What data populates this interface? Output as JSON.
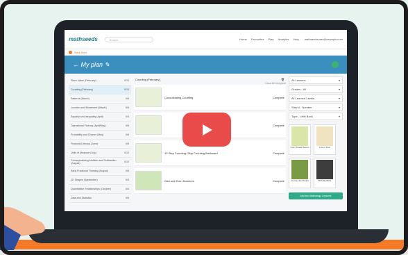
{
  "app": {
    "logo": "mathseeds",
    "search_placeholder": "Search"
  },
  "nav": {
    "links": [
      "Home",
      "Favourites",
      "Plan",
      "Analytics",
      "Help"
    ],
    "email": "mathseedsuser@example.com"
  },
  "back": {
    "label": "Back Alert"
  },
  "header": {
    "title": "My plan"
  },
  "months": [
    {
      "label": "Place Value (February)",
      "count": "0/10"
    },
    {
      "label": "Counting (February)",
      "count": "0/10",
      "active": true
    },
    {
      "label": "Patterns (March)",
      "count": "0/6"
    },
    {
      "label": "Location and Movement (March)",
      "count": "0/6"
    },
    {
      "label": "Equality and Inequality (April)",
      "count": "0/4"
    },
    {
      "label": "Operational Fluency (April/May)",
      "count": "0/6"
    },
    {
      "label": "Probability and Chance (May)",
      "count": "0/6"
    },
    {
      "label": "Financial Literacy (June)",
      "count": "0/6"
    },
    {
      "label": "Units of Measure (July)",
      "count": "0/10"
    },
    {
      "label": "Conceptualising Addition and Subtraction (August)",
      "count": "0/10"
    },
    {
      "label": "Early Fractional Thinking (August)",
      "count": "0/6"
    },
    {
      "label": "2D Shapes (September)",
      "count": "0/4"
    },
    {
      "label": "Quantitative Relationships (October)",
      "count": "0/6"
    },
    {
      "label": "Data and Statistics",
      "count": "0/6"
    }
  ],
  "main": {
    "title": "Counting (February)",
    "clear": "Clear All Complete",
    "items": [
      {
        "title": "Consolidating Counting",
        "complete": "Complete"
      },
      {
        "title": "",
        "complete": "Complete"
      },
      {
        "title": "10 Step Counting: Skip Counting Backward",
        "complete": "Complete"
      },
      {
        "title": "Odd and Even Numbers",
        "complete": "Complete"
      }
    ]
  },
  "filters": [
    "All Lessons",
    "Grades - All",
    "All Learned Levels",
    "Strand - Number",
    "Type - Little Book"
  ],
  "cards": [
    "Open Snake Racers",
    "Lots of Dots",
    "Journey the Market",
    "Birthday Bobs"
  ],
  "add_button": "Add two Mathology Lessons",
  "colors": {
    "header": "#3a8fbf",
    "accent": "#f47a2a",
    "play": "#e94a4a"
  },
  "icons": [
    "play-icon",
    "pencil-icon",
    "trash-icon",
    "back-arrow-icon"
  ]
}
